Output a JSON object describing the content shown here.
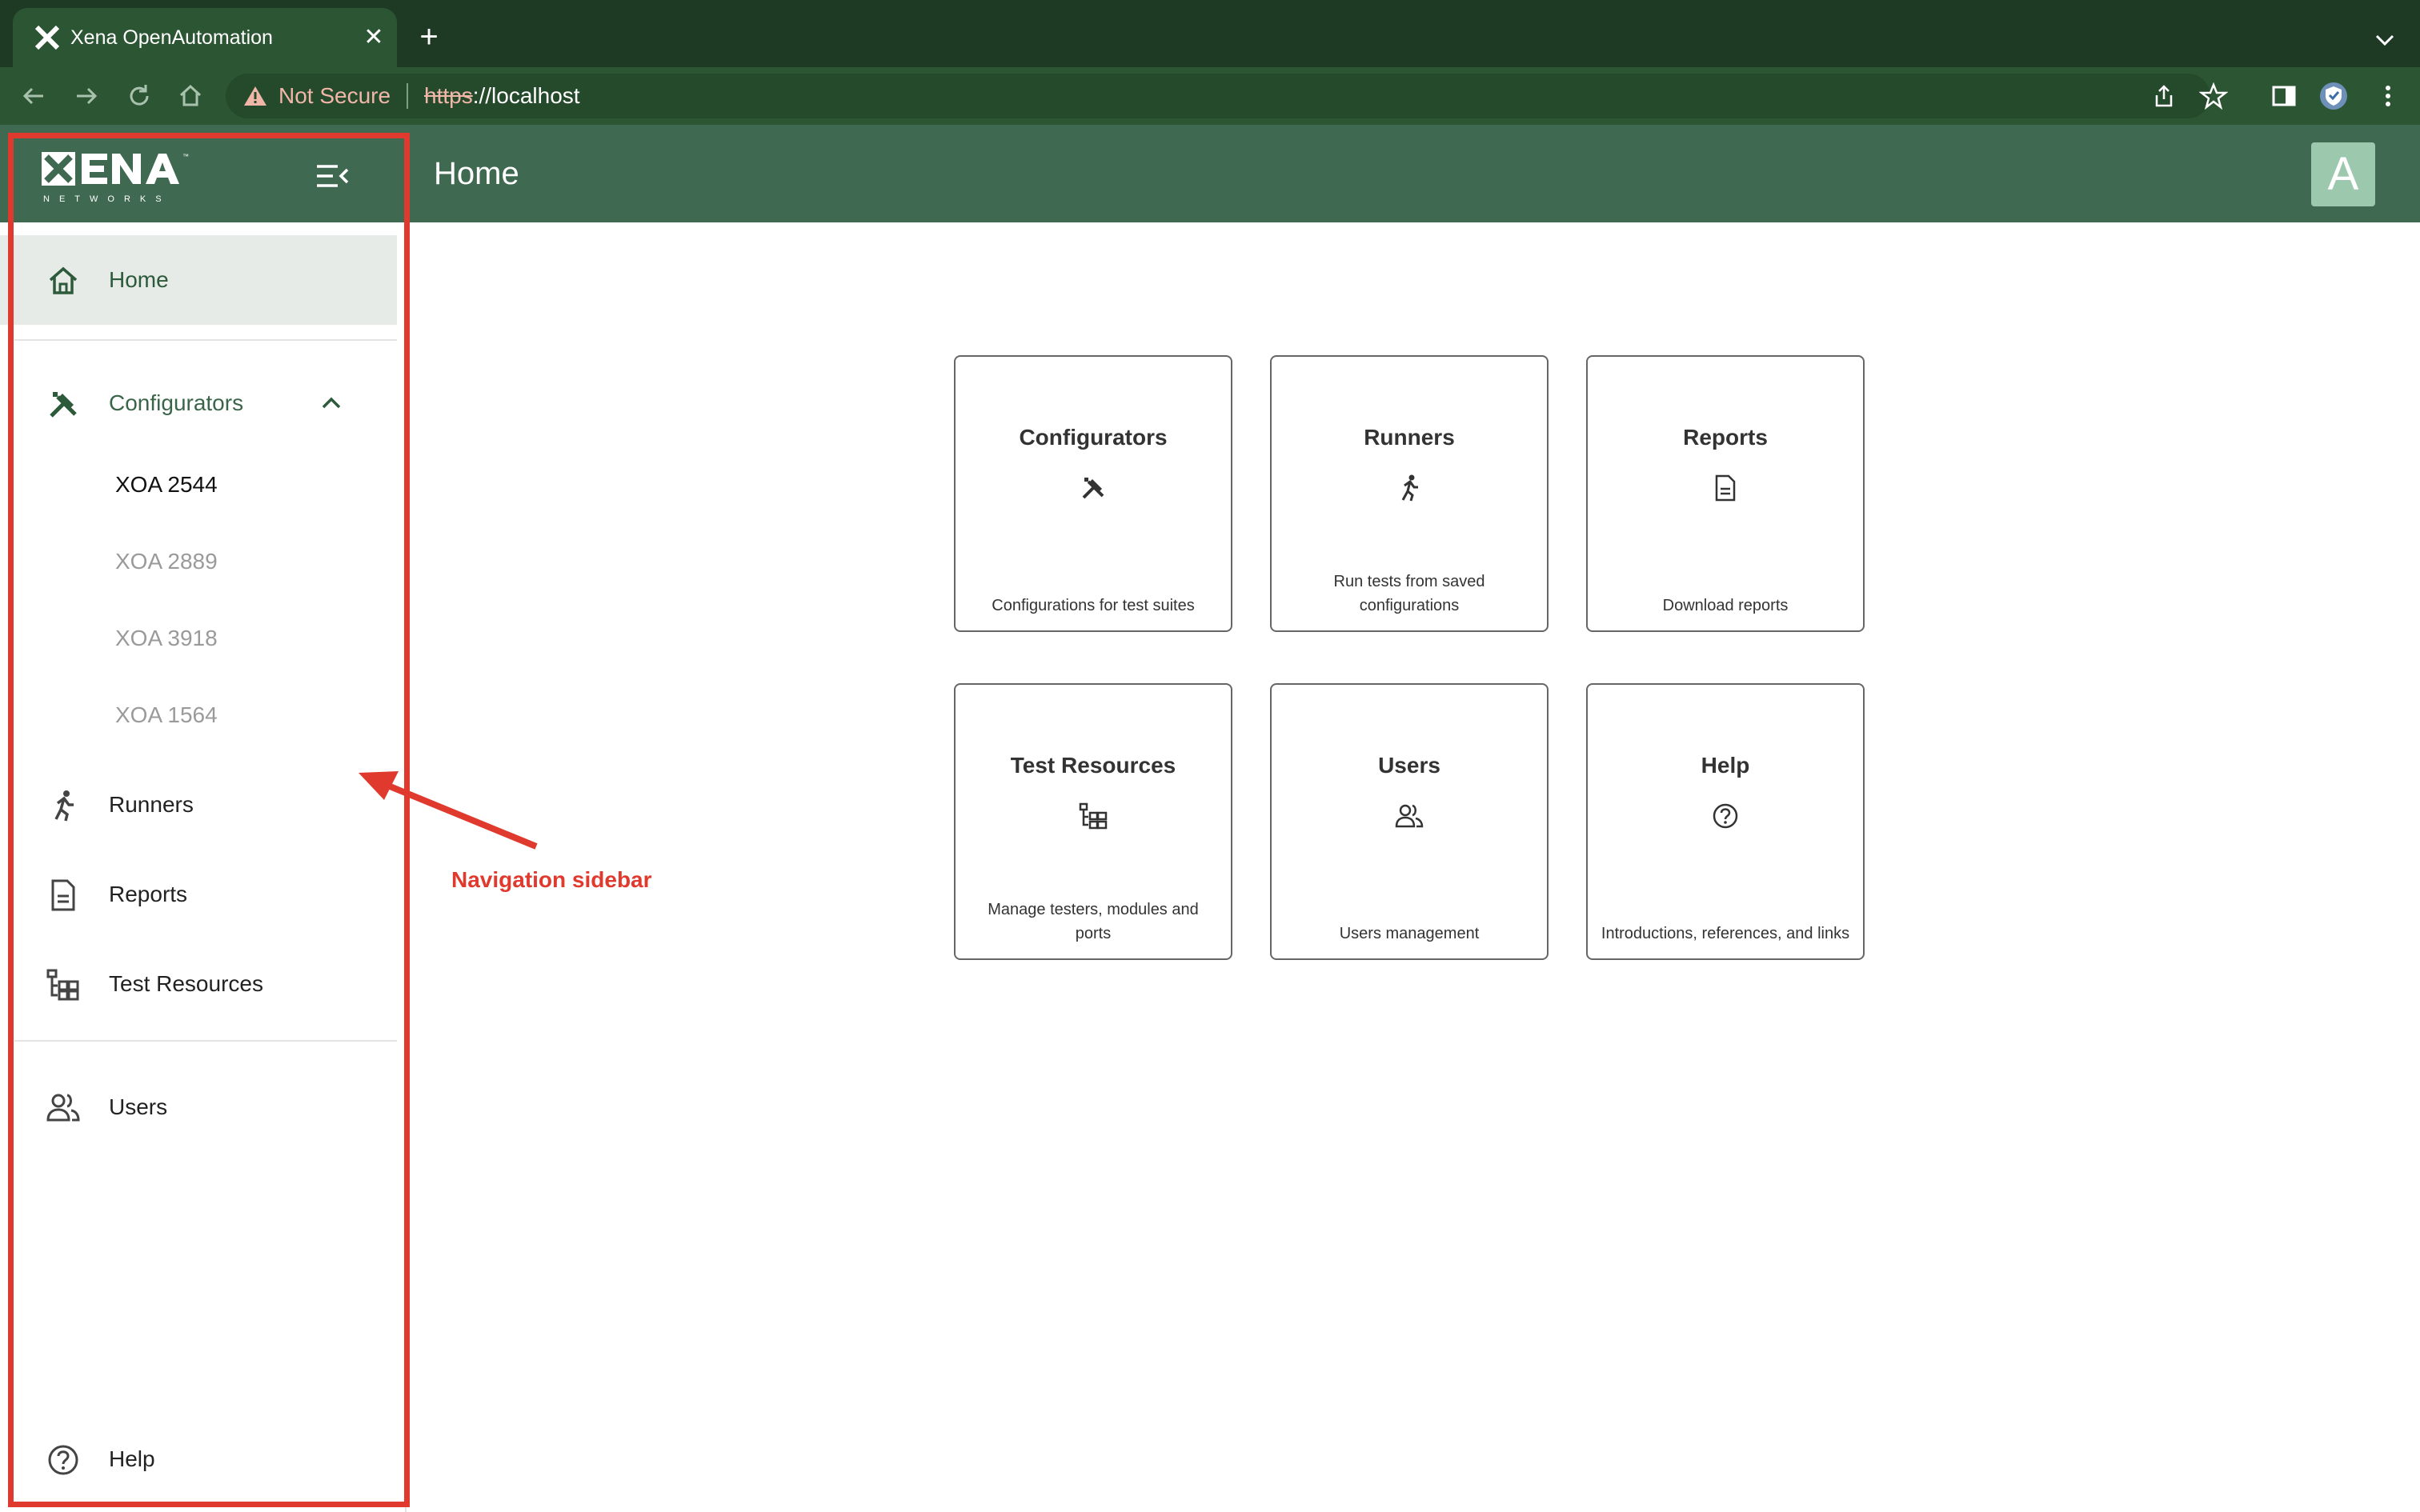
{
  "browser": {
    "tab_title": "Xena OpenAutomation",
    "tab_close": "✕",
    "new_tab": "+",
    "security_label": "Not Secure",
    "url_scheme": "https",
    "url_rest": "://localhost"
  },
  "header": {
    "page_title": "Home",
    "avatar_letter": "A",
    "logo_text": "XENA",
    "logo_subtext": "NETWORKS"
  },
  "sidebar": {
    "home": "Home",
    "configurators": "Configurators",
    "configurator_items": [
      "XOA 2544",
      "XOA 2889",
      "XOA 3918",
      "XOA 1564"
    ],
    "runners": "Runners",
    "reports": "Reports",
    "test_resources": "Test Resources",
    "users": "Users",
    "help": "Help"
  },
  "annotation": {
    "label": "Navigation sidebar",
    "color": "#e03a2e"
  },
  "cards": [
    {
      "title": "Configurators",
      "icon": "tools-icon",
      "description": "Configurations for test suites"
    },
    {
      "title": "Runners",
      "icon": "runner-icon",
      "description": "Run tests from saved configurations"
    },
    {
      "title": "Reports",
      "icon": "document-icon",
      "description": "Download reports"
    },
    {
      "title": "Test Resources",
      "icon": "resources-tree-icon",
      "description": "Manage testers, modules and ports"
    },
    {
      "title": "Users",
      "icon": "users-icon",
      "description": "Users management"
    },
    {
      "title": "Help",
      "icon": "help-circle-icon",
      "description": "Introductions, references, and links"
    }
  ],
  "colors": {
    "chrome_dark": "#1e3a24",
    "chrome_toolbar": "#2c5533",
    "header": "#3f6a51",
    "accent": "#2d5a3a",
    "avatar": "#9cc9ad"
  }
}
